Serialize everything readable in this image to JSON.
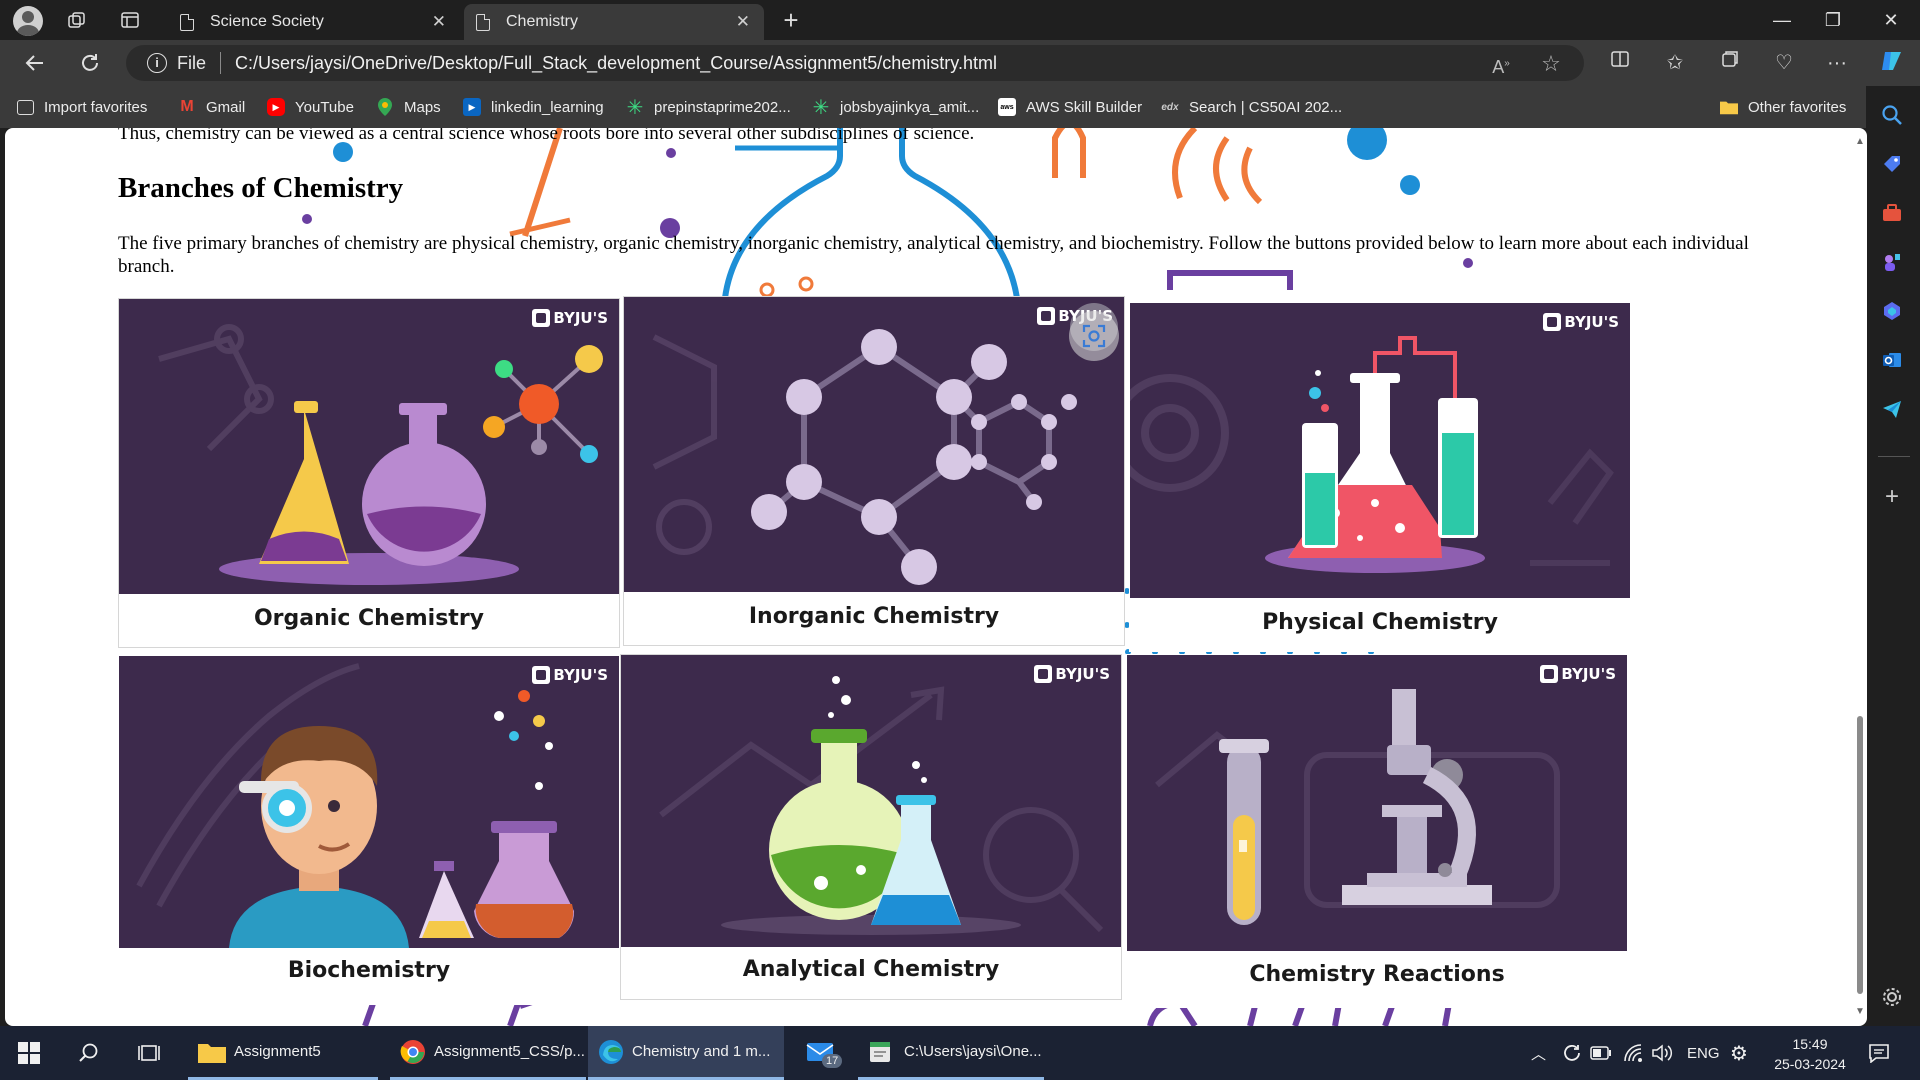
{
  "browser": {
    "tabs": [
      {
        "title": "Science Society",
        "active": false
      },
      {
        "title": "Chemistry",
        "active": true
      }
    ],
    "address": {
      "protocol_label": "File",
      "url": "C:/Users/jaysi/OneDrive/Desktop/Full_Stack_development_Course/Assignment5/chemistry.html"
    },
    "favorites": [
      {
        "label": "Import favorites",
        "icon": "import-icon"
      },
      {
        "label": "Gmail",
        "icon": "gmail-icon"
      },
      {
        "label": "YouTube",
        "icon": "youtube-icon"
      },
      {
        "label": "Maps",
        "icon": "maps-icon"
      },
      {
        "label": "linkedin_learning",
        "icon": "linkedin-learning-icon"
      },
      {
        "label": "prepinstaprime202...",
        "icon": "prepinsta-icon"
      },
      {
        "label": "jobsbyajinkya_amit...",
        "icon": "jobs-icon"
      },
      {
        "label": "AWS Skill Builder",
        "icon": "aws-icon"
      },
      {
        "label": "Search | CS50AI 202...",
        "icon": "edx-icon"
      },
      {
        "label": "Other favorites",
        "icon": "folder-icon"
      }
    ]
  },
  "page": {
    "intro_tail": "Thus, chemistry can be viewed as a central science whose roots bore into several other subdisciplines of science.",
    "heading": "Branches of Chemistry",
    "paragraph": "The five primary branches of chemistry are physical chemistry, organic chemistry, inorganic chemistry, analytical chemistry, and biochemistry. Follow the buttons provided below to learn more about each individual branch.",
    "brand": "BYJU'S",
    "cards": [
      {
        "label": "Organic Chemistry"
      },
      {
        "label": "Inorganic Chemistry"
      },
      {
        "label": "Physical Chemistry"
      },
      {
        "label": "Biochemistry"
      },
      {
        "label": "Analytical Chemistry"
      },
      {
        "label": "Chemistry Reactions"
      }
    ]
  },
  "taskbar": {
    "apps": [
      {
        "label": "Assignment5",
        "icon": "folder-icon"
      },
      {
        "label": "Assignment5_CSS/p...",
        "icon": "chrome-icon"
      },
      {
        "label": "Chemistry and 1 m...",
        "icon": "edge-icon"
      },
      {
        "label": "17",
        "icon": "mail-icon"
      },
      {
        "label": "C:\\Users\\jaysi\\One...",
        "icon": "notepad-icon"
      }
    ],
    "tray": {
      "language": "ENG",
      "time": "15:49",
      "date": "25-03-2024"
    }
  }
}
